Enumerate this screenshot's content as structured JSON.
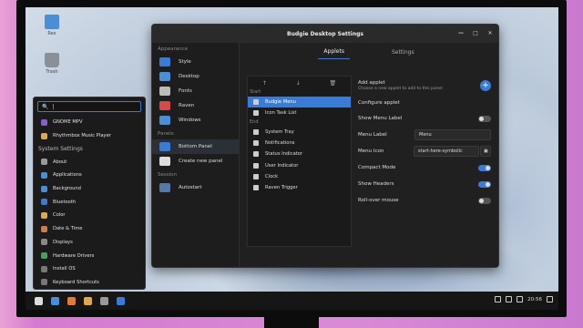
{
  "desktop": {
    "icons": [
      {
        "label": "Rex",
        "icon": "home-folder-icon"
      },
      {
        "label": "Trash",
        "icon": "trash-icon"
      }
    ]
  },
  "menu": {
    "search_value": "|",
    "top_items": [
      {
        "label": "GNOME MPV",
        "icon": "mpv-icon",
        "color": "#8a5bd6"
      },
      {
        "label": "Rhythmbox Music Player",
        "icon": "rhythmbox-icon",
        "color": "#e0a84a"
      }
    ],
    "category": "System Settings",
    "items": [
      {
        "label": "About",
        "icon": "info-icon",
        "color": "#999999"
      },
      {
        "label": "Applications",
        "icon": "applications-icon",
        "color": "#4a8fd6"
      },
      {
        "label": "Background",
        "icon": "background-icon",
        "color": "#4a8fd6"
      },
      {
        "label": "Bluetooth",
        "icon": "bluetooth-icon",
        "color": "#3a7bd5"
      },
      {
        "label": "Color",
        "icon": "color-icon",
        "color": "#e0a84a"
      },
      {
        "label": "Date & Time",
        "icon": "clock-icon",
        "color": "#d8774a"
      },
      {
        "label": "Displays",
        "icon": "display-icon",
        "color": "#888888"
      },
      {
        "label": "Hardware Drivers",
        "icon": "drivers-icon",
        "color": "#4aa05a"
      },
      {
        "label": "Install OS",
        "icon": "install-icon",
        "color": "#777777"
      },
      {
        "label": "Keyboard Shortcuts",
        "icon": "keyboard-icon",
        "color": "#777777"
      }
    ]
  },
  "window": {
    "title": "Budgie Desktop Settings",
    "tabs": [
      {
        "label": "Applets",
        "active": true
      },
      {
        "label": "Settings",
        "active": false
      }
    ],
    "sidebar": {
      "sections": [
        {
          "heading": "Appearance",
          "items": [
            {
              "label": "Style",
              "icon": "style-icon",
              "color": "#3a7bd5"
            },
            {
              "label": "Desktop",
              "icon": "desktop-icon",
              "color": "#4a8fd6"
            },
            {
              "label": "Fonts",
              "icon": "fonts-icon",
              "color": "#bbbbbb"
            },
            {
              "label": "Raven",
              "icon": "raven-icon",
              "color": "#d64a4a"
            },
            {
              "label": "Windows",
              "icon": "windows-icon",
              "color": "#4a8fd6"
            }
          ]
        },
        {
          "heading": "Panels",
          "items": [
            {
              "label": "Bottom Panel",
              "icon": "panel-icon",
              "color": "#3a7bd5",
              "active": true
            },
            {
              "label": "Create new panel",
              "icon": "plus-icon",
              "color": "#dddddd"
            }
          ]
        },
        {
          "heading": "Session",
          "items": [
            {
              "label": "Autostart",
              "icon": "autostart-icon",
              "color": "#5577aa"
            }
          ]
        }
      ]
    },
    "applets": {
      "toolbar": [
        "↑",
        "↓",
        "🗑"
      ],
      "start_label": "Start",
      "start_items": [
        {
          "label": "Budgie Menu",
          "selected": true
        },
        {
          "label": "Icon Task List"
        }
      ],
      "end_label": "End",
      "end_items": [
        {
          "label": "System Tray"
        },
        {
          "label": "Notifications"
        },
        {
          "label": "Status Indicator"
        },
        {
          "label": "User Indicator"
        },
        {
          "label": "Clock"
        },
        {
          "label": "Raven Trigger"
        }
      ]
    },
    "settings": {
      "add_applet_title": "Add applet",
      "add_applet_desc": "Choose a new applet to add to this panel",
      "configure_label": "Configure applet",
      "show_menu_label": {
        "label": "Show Menu Label",
        "on": false
      },
      "menu_label": {
        "label": "Menu Label",
        "value": "Menu"
      },
      "menu_icon": {
        "label": "Menu Icon",
        "value": "start-here-symbolic"
      },
      "compact_mode": {
        "label": "Compact Mode",
        "on": true
      },
      "show_headers": {
        "label": "Show Headers",
        "on": true
      },
      "rollover_menu": {
        "label": "Roll-over mouse",
        "on": false
      }
    }
  },
  "panel": {
    "apps": [
      {
        "icon": "menu-grid-icon",
        "color": "#dddddd"
      },
      {
        "icon": "files-icon",
        "color": "#4a8fd6"
      },
      {
        "icon": "firefox-icon",
        "color": "#e07a3a"
      },
      {
        "icon": "rhythmbox-icon",
        "color": "#e0a84a"
      },
      {
        "icon": "settings-icon",
        "color": "#999999"
      },
      {
        "icon": "budgie-settings-icon",
        "color": "#3a7bd5"
      }
    ],
    "time": "20:56"
  }
}
